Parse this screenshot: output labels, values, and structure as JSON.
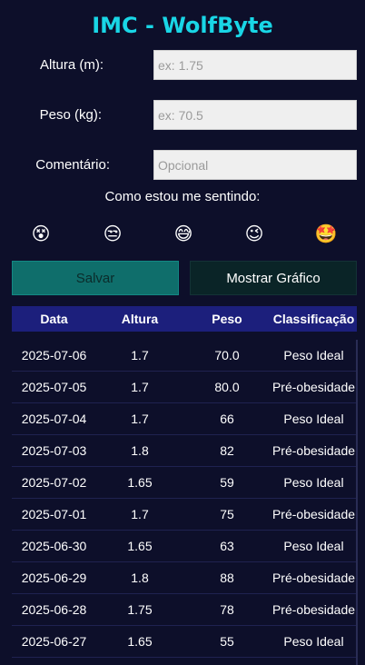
{
  "app": {
    "title": "IMC - WolfByte"
  },
  "form": {
    "height_label": "Altura (m):",
    "height_placeholder": "ex: 1.75",
    "weight_label": "Peso (kg):",
    "weight_placeholder": "ex: 70.5",
    "comment_label": "Comentário:",
    "comment_placeholder": "Opcional"
  },
  "mood": {
    "prompt": "Como estou me sentindo:",
    "options": [
      {
        "icon": "dizzy-face-icon",
        "glyph": "😵"
      },
      {
        "icon": "unamused-face-icon",
        "glyph": "😒"
      },
      {
        "icon": "sweat-smile-face-icon",
        "glyph": "😅"
      },
      {
        "icon": "winking-face-icon",
        "glyph": "😉"
      },
      {
        "icon": "star-struck-face-icon",
        "glyph": "🤩"
      }
    ]
  },
  "buttons": {
    "save": "Salvar",
    "show_chart": "Mostrar Gráfico"
  },
  "table": {
    "headers": [
      "Data",
      "Altura",
      "Peso",
      "Classificação"
    ],
    "rows": [
      [
        "2025-07-06",
        "1.7",
        "70.0",
        "Peso Ideal"
      ],
      [
        "2025-07-05",
        "1.7",
        "80.0",
        "Pré-obesidade"
      ],
      [
        "2025-07-04",
        "1.7",
        "66",
        "Peso Ideal"
      ],
      [
        "2025-07-03",
        "1.8",
        "82",
        "Pré-obesidade"
      ],
      [
        "2025-07-02",
        "1.65",
        "59",
        "Peso Ideal"
      ],
      [
        "2025-07-01",
        "1.7",
        "75",
        "Pré-obesidade"
      ],
      [
        "2025-06-30",
        "1.65",
        "63",
        "Peso Ideal"
      ],
      [
        "2025-06-29",
        "1.8",
        "88",
        "Pré-obesidade"
      ],
      [
        "2025-06-28",
        "1.75",
        "78",
        "Pré-obesidade"
      ],
      [
        "2025-06-27",
        "1.65",
        "55",
        "Peso Ideal"
      ]
    ]
  },
  "colors": {
    "background": "#0d0f2a",
    "title": "#19d6e6",
    "header": "#1c1f7c",
    "save_button": "#0f6e6b",
    "chart_button": "#0a2427"
  }
}
